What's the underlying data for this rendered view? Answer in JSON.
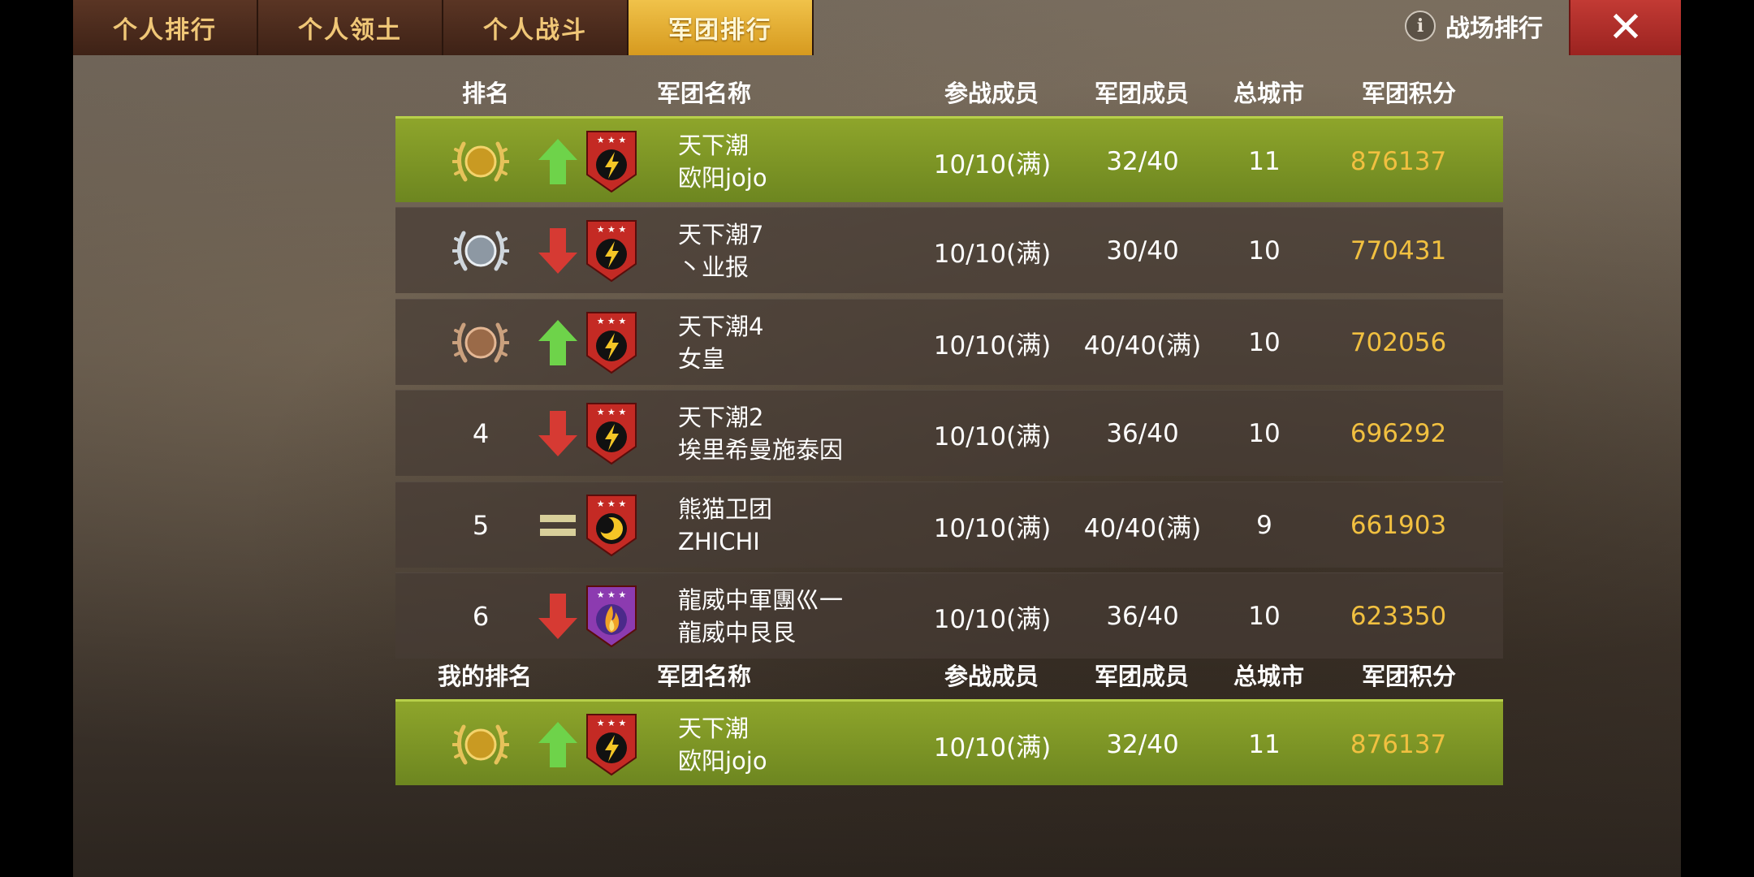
{
  "tabs": [
    {
      "label": "个人排行",
      "active": false
    },
    {
      "label": "个人领土",
      "active": false
    },
    {
      "label": "个人战斗",
      "active": false
    },
    {
      "label": "军团排行",
      "active": true
    }
  ],
  "header": {
    "info_icon": "info-icon",
    "title": "战场排行",
    "close_icon": "close-icon",
    "close_glyph": "✕"
  },
  "columns": {
    "rank": "排名",
    "legion_name": "军团名称",
    "active_members": "参战成员",
    "legion_members": "军团成员",
    "total_cities": "总城市",
    "legion_score": "军团积分"
  },
  "my_columns": {
    "rank": "我的排名",
    "legion_name": "军团名称",
    "active_members": "参战成员",
    "legion_members": "军团成员",
    "total_cities": "总城市",
    "legion_score": "军团积分"
  },
  "rows": [
    {
      "rank": "1",
      "medal": "gold",
      "trend": "up",
      "emblem": "lightning",
      "name": "天下潮",
      "leader": "欧阳jojo",
      "active": "10/10(满)",
      "members": "32/40",
      "cities": "11",
      "score": "876137"
    },
    {
      "rank": "2",
      "medal": "silver",
      "trend": "down",
      "emblem": "lightning",
      "name": "天下潮7",
      "leader": "丶业报",
      "active": "10/10(满)",
      "members": "30/40",
      "cities": "10",
      "score": "770431"
    },
    {
      "rank": "3",
      "medal": "bronze",
      "trend": "up",
      "emblem": "lightning",
      "name": "天下潮4",
      "leader": "女皇",
      "active": "10/10(满)",
      "members": "40/40(满)",
      "cities": "10",
      "score": "702056"
    },
    {
      "rank": "4",
      "medal": "",
      "trend": "down",
      "emblem": "lightning",
      "name": "天下潮2",
      "leader": "埃里希曼施泰因",
      "active": "10/10(满)",
      "members": "36/40",
      "cities": "10",
      "score": "696292"
    },
    {
      "rank": "5",
      "medal": "",
      "trend": "same",
      "emblem": "moon",
      "name": "熊猫卫团",
      "leader": "ZHICHI",
      "active": "10/10(满)",
      "members": "40/40(满)",
      "cities": "9",
      "score": "661903"
    },
    {
      "rank": "6",
      "medal": "",
      "trend": "down",
      "emblem": "flame",
      "name": "龍威中軍團巛一",
      "leader": "龍威中艮艮",
      "active": "10/10(满)",
      "members": "36/40",
      "cities": "10",
      "score": "623350"
    }
  ],
  "my_row": {
    "rank": "1",
    "medal": "gold",
    "trend": "up",
    "emblem": "lightning",
    "name": "天下潮",
    "leader": "欧阳jojo",
    "active": "10/10(满)",
    "members": "32/40",
    "cities": "11",
    "score": "876137"
  },
  "colors": {
    "tab_active": "#e3b030",
    "tab_inactive": "#4a2b1c",
    "highlight_row": "#7f9726",
    "score": "#f1c040",
    "close": "#b22e2a",
    "arrow_up": "#6ed34a",
    "arrow_down": "#d63a33"
  }
}
